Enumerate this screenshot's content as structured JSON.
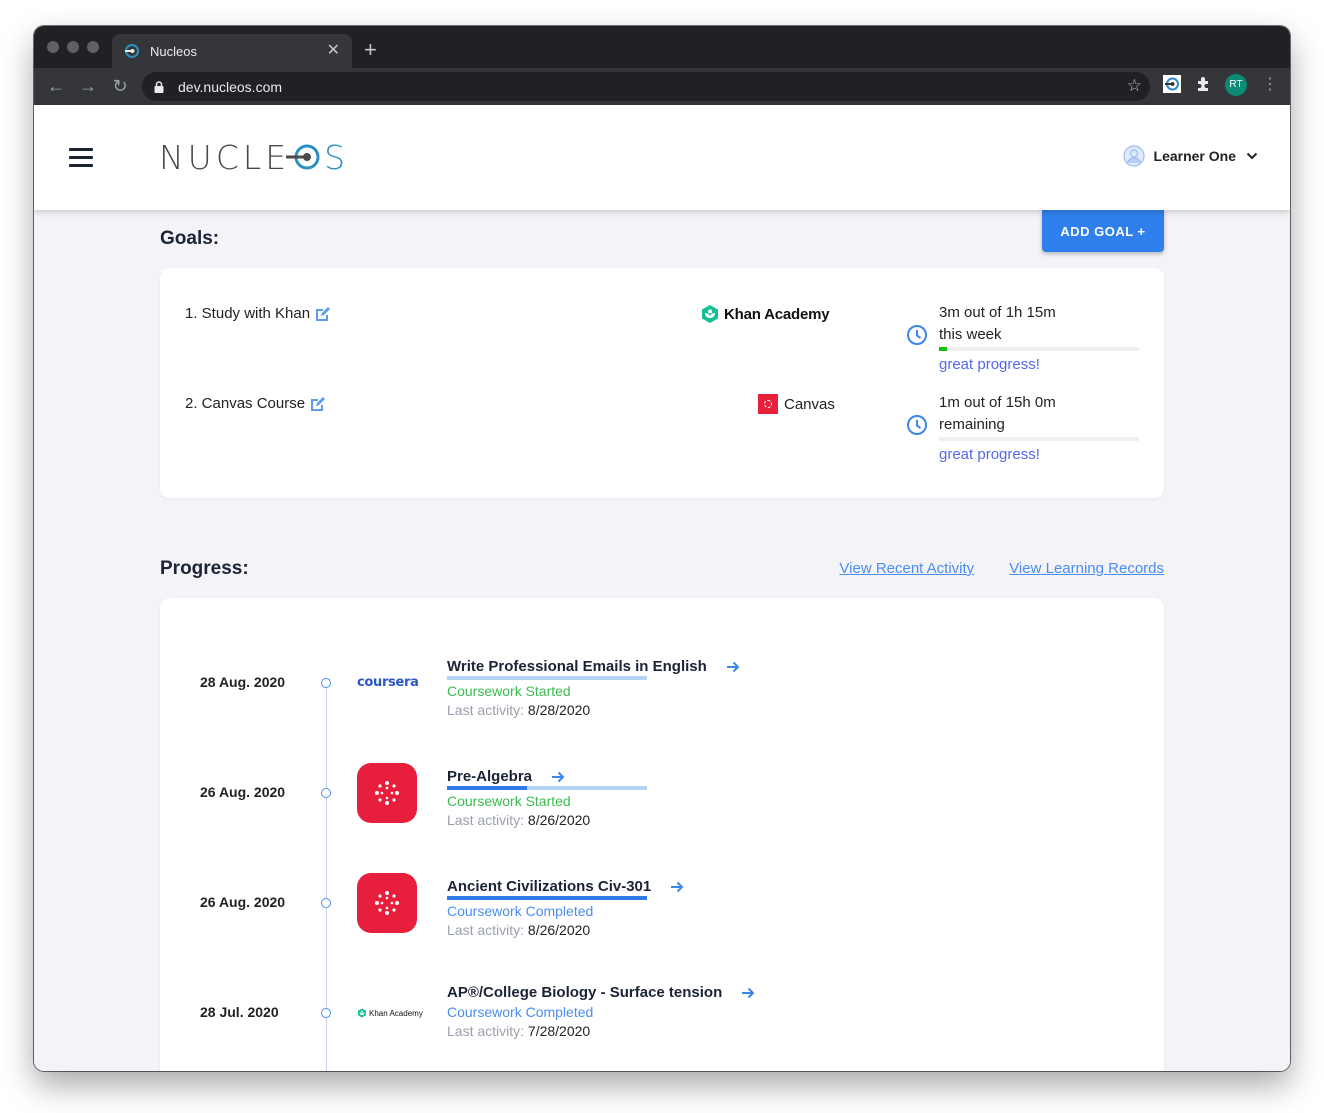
{
  "browser": {
    "tab_title": "Nucleos",
    "url": "dev.nucleos.com",
    "profile_initials": "RT"
  },
  "header": {
    "logo_text": "NUCLE",
    "logo_o": "O",
    "logo_s": "S",
    "user_name": "Learner One"
  },
  "goals": {
    "title": "Goals:",
    "add_button": "ADD GOAL +",
    "items": [
      {
        "name": "1. Study with Khan",
        "provider": "Khan Academy",
        "line1": "3m out of 1h 15m",
        "line2": "this week",
        "progress_percent": 4,
        "message": "great progress!"
      },
      {
        "name": "2. Canvas Course",
        "provider": "Canvas",
        "line1": "1m out of 15h 0m",
        "line2": "remaining",
        "progress_percent": 0,
        "message": "great progress!"
      }
    ]
  },
  "progress": {
    "title": "Progress:",
    "link_recent": "View Recent Activity",
    "link_records": "View Learning Records",
    "last_activity_label": "Last activity:",
    "entries": [
      {
        "date": "28 Aug. 2020",
        "provider": "coursera",
        "title": "Write Professional Emails in English",
        "status": "Coursework Started",
        "progress_percent": 0,
        "last_activity": "8/28/2020"
      },
      {
        "date": "26 Aug. 2020",
        "provider": "Canvas",
        "title": "Pre-Algebra",
        "status": "Coursework Started",
        "progress_percent": 40,
        "last_activity": "8/26/2020"
      },
      {
        "date": "26 Aug. 2020",
        "provider": "Canvas",
        "title": "Ancient Civilizations Civ-301",
        "status": "Coursework Completed",
        "progress_percent": 100,
        "last_activity": "8/26/2020"
      },
      {
        "date": "28 Jul. 2020",
        "provider": "Khan Academy",
        "title": "AP®/College Biology - Surface tension",
        "status": "Coursework Completed",
        "progress_percent": 100,
        "last_activity": "7/28/2020"
      }
    ]
  },
  "colors": {
    "accent": "#2f80ed",
    "canvas_red": "#e71f3d",
    "started_green": "#3cba54",
    "completed_blue": "#4a8ef0",
    "encourage_purple": "#5566ee",
    "goal_bar_green": "#10c010"
  }
}
